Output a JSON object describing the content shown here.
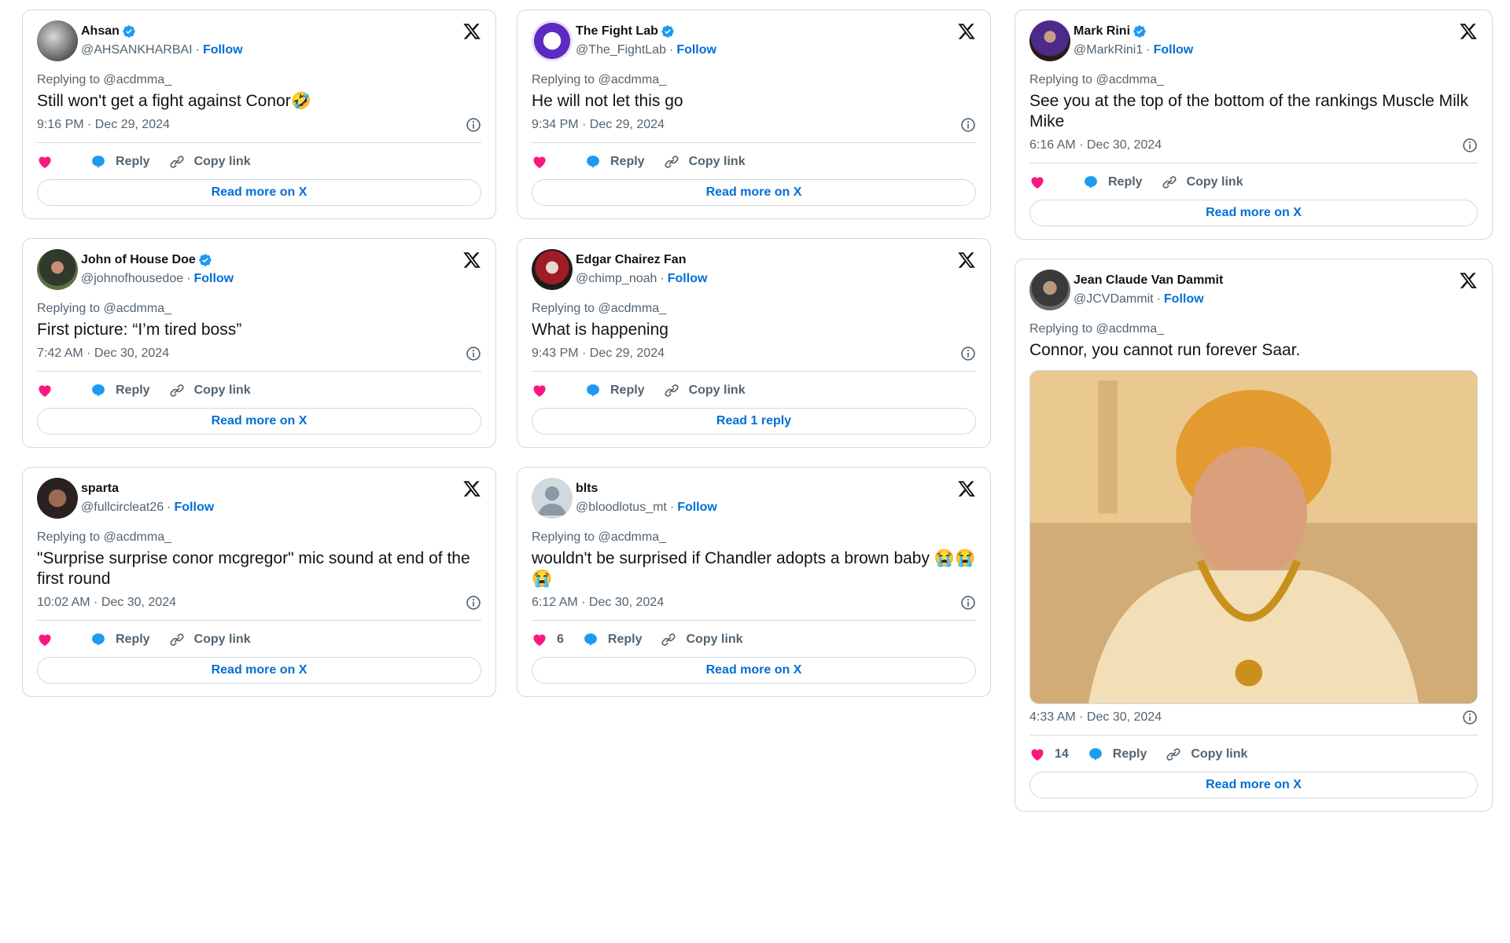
{
  "common": {
    "follow_label": "Follow",
    "reply_label": "Reply",
    "copy_link_label": "Copy link",
    "separator": "·"
  },
  "colors": {
    "accent": "#006fd6",
    "like": "#f91880",
    "reply": "#1d9bf0",
    "verified": "#1d9bf0",
    "muted": "#536471",
    "border": "#cfd9de"
  },
  "tweets": [
    {
      "name": "Ahsan",
      "verified": true,
      "handle": "@AHSANKHARBAI",
      "replying": "Replying to @acdmma_",
      "text": "Still won't get a fight against Conor🤣",
      "time": "9:16 PM · Dec 29, 2024",
      "likes": "",
      "button": "Read more on X"
    },
    {
      "name": "The Fight Lab",
      "verified": true,
      "handle": "@The_FightLab",
      "replying": "Replying to @acdmma_",
      "text": "He will not let this go",
      "time": "9:34 PM · Dec 29, 2024",
      "likes": "",
      "button": "Read more on X"
    },
    {
      "name": "Mark Rini",
      "verified": true,
      "handle": "@MarkRini1",
      "replying": "Replying to @acdmma_",
      "text": "See you at the top of the bottom of the rankings Muscle Milk Mike",
      "time": "6:16 AM · Dec 30, 2024",
      "likes": "",
      "button": "Read more on X"
    },
    {
      "name": "John of House Doe",
      "verified": true,
      "handle": "@johnofhousedoe",
      "replying": "Replying to @acdmma_",
      "text": "First picture: “I’m tired boss”",
      "time": "7:42 AM · Dec 30, 2024",
      "likes": "",
      "button": "Read more on X"
    },
    {
      "name": "Edgar Chairez Fan",
      "verified": false,
      "handle": "@chimp_noah",
      "replying": "Replying to @acdmma_",
      "text": "What is happening",
      "time": "9:43 PM · Dec 29, 2024",
      "likes": "",
      "button": "Read 1 reply"
    },
    {
      "name": "Jean Claude Van Dammit",
      "verified": false,
      "handle": "@JCVDammit",
      "replying": "Replying to @acdmma_",
      "text": "Connor, you cannot run forever Saar.",
      "time": "4:33 AM · Dec 30, 2024",
      "likes": "14",
      "button": "Read more on X",
      "media": "photo-man-in-orange-turban"
    },
    {
      "name": "sparta",
      "verified": false,
      "handle": "@fullcircleat26",
      "replying": "Replying to @acdmma_",
      "text": "\"Surprise surprise conor mcgregor\" mic sound at end of the first round",
      "time": "10:02 AM · Dec 30, 2024",
      "likes": "",
      "button": "Read more on X"
    },
    {
      "name": "blts",
      "verified": false,
      "handle": "@bloodlotus_mt",
      "replying": "Replying to @acdmma_",
      "text": "wouldn't be surprised if Chandler adopts a brown baby 😭😭😭",
      "time": "6:12 AM · Dec 30, 2024",
      "likes": "6",
      "button": "Read more on X"
    }
  ]
}
